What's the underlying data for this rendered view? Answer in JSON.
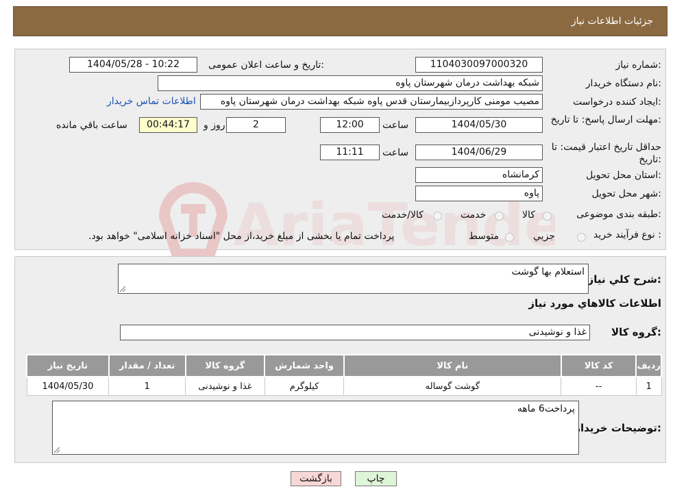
{
  "header": {
    "title": "جزئیات اطلاعات نیاز"
  },
  "form": {
    "need_number_label": "شماره نیاز:",
    "need_number": "1104030097000320",
    "announce_label": "تاریخ و ساعت اعلان عمومی:",
    "announce_value": "1404/05/28 - 10:22",
    "buyer_org_label": "نام دستگاه خریدار:",
    "buyer_org": "شبکه بهداشت درمان شهرستان پاوه",
    "requester_label": "ایجاد کننده درخواست:",
    "requester": "مصیب مومنی کارپردازبیمارستان قدس پاوه شبکه بهداشت درمان شهرستان پاوه",
    "contact_link": "اطلاعات تماس خریدار",
    "deadline_label": "مهلت ارسال پاسخ: تا تاریخ:",
    "deadline_date": "1404/05/30",
    "time_label": "ساعت",
    "deadline_time": "12:00",
    "days": "2",
    "days_suffix": "روز و",
    "remaining": "00:44:17",
    "remaining_suffix": "ساعت باقي مانده",
    "validity_label": "حداقل تاریخ اعتبار قیمت: تا تاریخ:",
    "validity_date": "1404/06/29",
    "validity_time": "11:11",
    "province_label": "استان محل تحویل:",
    "province": "کرمانشاه",
    "city_label": "شهر محل تحویل:",
    "city": "پاوه",
    "category_label": "طبقه بندی موضوعی:",
    "category_options": [
      "کالا",
      "خدمت",
      "کالا/خدمت"
    ],
    "process_label": "نوع فرآیند خرید :",
    "process_options": [
      "جزیي",
      "متوسط"
    ],
    "process_note": "پرداخت تمام یا بخشی از مبلغ خرید،از محل \"اسناد خزانه اسلامی\" خواهد بود."
  },
  "details": {
    "description_label": "شرح کلي نیاز:",
    "description": "استعلام بها گوشت",
    "goods_title": "اطلاعات کالاهاي مورد نیاز",
    "group_label": "گروه کالا:",
    "group_value": "غذا و نوشیدنی",
    "table_headers": [
      "ردیف",
      "کد کالا",
      "نام کالا",
      "واحد شمارش",
      "گروه کالا",
      "تعداد / مقدار",
      "تاریخ نیاز"
    ],
    "rows": [
      {
        "row": "1",
        "code": "--",
        "name": "گوشت گوساله",
        "unit": "کیلوگرم",
        "group": "غذا و نوشیدنی",
        "qty": "1",
        "date": "1404/05/30"
      }
    ],
    "buyer_notes_label": "توضیحات خریدار:",
    "buyer_notes": "پرداخت6 ماهه"
  },
  "buttons": {
    "back": "بازگشت",
    "print": "چاپ"
  },
  "watermark": {
    "text": "AriaTender.neT"
  },
  "colors": {
    "header_bg": "#8b6a42",
    "link": "#1a4fb5",
    "back_button_bg": "#f8d7d7",
    "print_button_bg": "#dff5d8"
  }
}
